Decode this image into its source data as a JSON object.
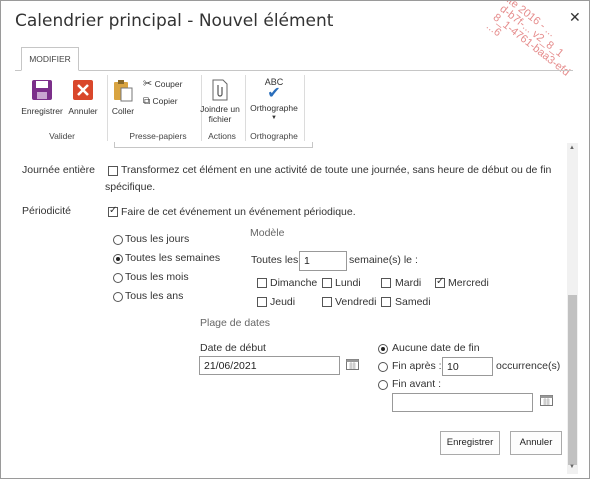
{
  "dialog": {
    "title": "Calendrier principal - Nouvel élément",
    "close": "✕"
  },
  "watermark": [
    "ite 2016 - ...",
    "d-b7f-... v2_8_1",
    "8_1-4761-baa3-efd",
    "...6"
  ],
  "ribbon": {
    "tab": "MODIFIER",
    "save": "Enregistrer",
    "cancel": "Annuler",
    "group_commit": "Valider",
    "paste": "Coller",
    "cut": "Couper",
    "copy": "Copier",
    "group_clipboard": "Presse-papiers",
    "attach_line1": "Joindre un",
    "attach_line2": "fichier",
    "group_actions": "Actions",
    "spell_icon_text": "ABC",
    "spelling": "Orthographe",
    "group_spelling": "Orthographe"
  },
  "form": {
    "all_day_label": "Journée entière",
    "all_day_text_line1": "Transformez cet élément en une activité de toute une journée, sans heure de début ou de fin",
    "all_day_text_line2": "spécifique.",
    "recurrence_label": "Périodicité",
    "recurrence_text": "Faire de cet événement un événement périodique.",
    "frequency": [
      "Tous les jours",
      "Toutes les semaines",
      "Tous les mois",
      "Tous les ans"
    ],
    "pattern_title": "Modèle",
    "every_label": "Toutes les",
    "every_value": "1",
    "week_suffix": "semaine(s) le :",
    "days": [
      "Dimanche",
      "Lundi",
      "Mardi",
      "Mercredi",
      "Jeudi",
      "Vendredi",
      "Samedi"
    ],
    "range_title": "Plage de dates",
    "start_label": "Date de début",
    "start_value": "21/06/2021",
    "no_end": "Aucune date de fin",
    "end_after": "Fin après :",
    "end_after_value": "10",
    "occurrences": "occurrence(s)",
    "end_before": "Fin avant :",
    "end_before_value": ""
  },
  "buttons": {
    "save": "Enregistrer",
    "cancel": "Annuler"
  },
  "colors": {
    "save_icon": "#7b2f8a",
    "cancel_icon": "#d9472b",
    "check": "#2a6ebb"
  }
}
